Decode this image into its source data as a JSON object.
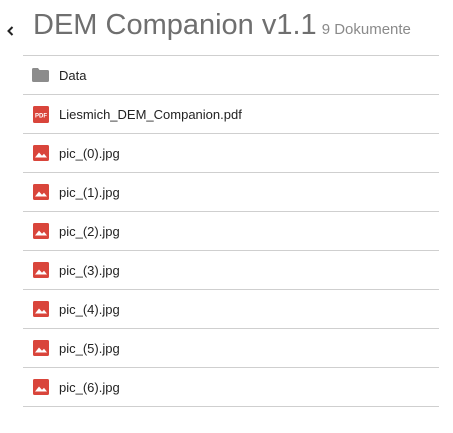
{
  "header": {
    "title": "DEM Companion v1.1",
    "doc_count": "9 Dokumente"
  },
  "files": [
    {
      "name": "Data",
      "icon": "folder-icon"
    },
    {
      "name": "Liesmich_DEM_Companion.pdf",
      "icon": "pdf-icon",
      "icon_text": "PDF"
    },
    {
      "name": "pic_(0).jpg",
      "icon": "image-icon"
    },
    {
      "name": "pic_(1).jpg",
      "icon": "image-icon"
    },
    {
      "name": "pic_(2).jpg",
      "icon": "image-icon"
    },
    {
      "name": "pic_(3).jpg",
      "icon": "image-icon"
    },
    {
      "name": "pic_(4).jpg",
      "icon": "image-icon"
    },
    {
      "name": "pic_(5).jpg",
      "icon": "image-icon"
    },
    {
      "name": "pic_(6).jpg",
      "icon": "image-icon"
    }
  ],
  "colors": {
    "folder": "#8c8c8c",
    "pdf": "#d9453b",
    "image": "#d9453b",
    "divider": "#cfcfcf",
    "title": "#6f6f6f"
  }
}
